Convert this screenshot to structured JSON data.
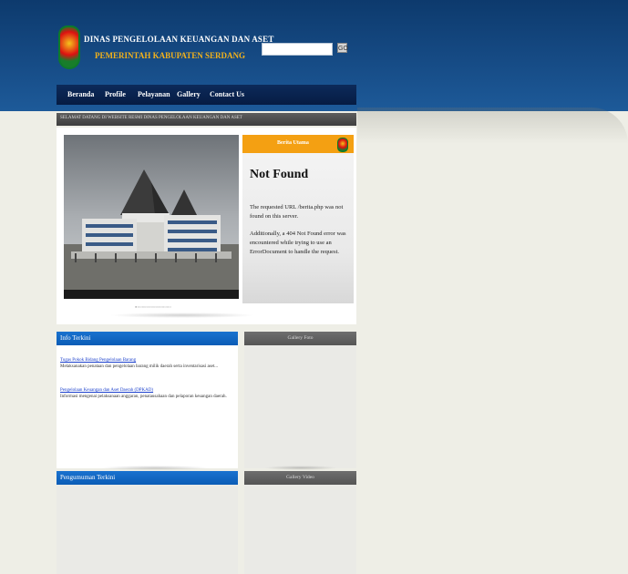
{
  "header": {
    "title": "DINAS PENGELOLAAN KEUANGAN DAN ASET",
    "subtitle": "PEMERINTAH KABUPATEN SERDANG",
    "search_button": "GO"
  },
  "nav": {
    "items": [
      {
        "label": "Beranda"
      },
      {
        "label": "Profile"
      },
      {
        "label": "Pelayanan"
      },
      {
        "label": "Gallery"
      },
      {
        "label": "Contact Us"
      }
    ]
  },
  "ticker": {
    "text": "SELAMAT DATANG DI WEBSITE RESMI DINAS PENGELOLAAN KEUANGAN DAN ASET"
  },
  "slider": {
    "dots": "▪▫▫▫▫▫▫▫▫▫▫▫▫▫▫▫"
  },
  "berita": {
    "header": "Berita Utama",
    "title": "Not Found",
    "text1": "The requested URL /berita.php was not found on this server.",
    "text2": "Additionally, a 404 Not Found error was encountered while trying to use an ErrorDocument to handle the request."
  },
  "info": {
    "header": "Info Terkini",
    "items": [
      {
        "link": "Tugas Pokok Bidang Pengelolaan Barang",
        "desc": "Melaksanakan penataan dan pengelolaan barang milik daerah serta inventarisasi aset..."
      },
      {
        "link": "Pengelolaan Keuangan dan Aset Daerah (DPKAD)",
        "desc": "Informasi mengenai pelaksanaan anggaran, penatausahaan dan pelaporan keuangan daerah."
      }
    ]
  },
  "gallery_foto": {
    "header": "Gallery Foto"
  },
  "gallery_video": {
    "header": "Gallery Video"
  },
  "pengumuman": {
    "header": "Pengumuman Terkini"
  },
  "colors": {
    "header_blue": "#164b85",
    "nav_dark": "#061c43",
    "berita_orange": "#f4a012",
    "section_blue": "#0b5cb6",
    "section_gray": "#555555",
    "page_bg": "#eeeee6"
  }
}
